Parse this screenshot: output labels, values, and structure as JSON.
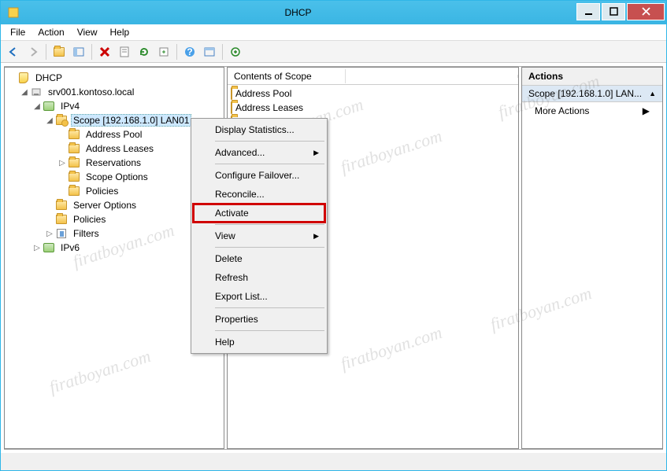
{
  "window": {
    "title": "DHCP"
  },
  "menubar": [
    "File",
    "Action",
    "View",
    "Help"
  ],
  "tree": {
    "root": "DHCP",
    "server": "srv001.kontoso.local",
    "ipv4": "IPv4",
    "ipv6": "IPv6",
    "scope": "Scope [192.168.1.0] LAN01",
    "addressPool": "Address Pool",
    "addressLeases": "Address Leases",
    "reservations": "Reservations",
    "scopeOptions": "Scope Options",
    "scopePolicies": "Policies",
    "serverOptions": "Server Options",
    "policies": "Policies",
    "filters": "Filters"
  },
  "mid": {
    "header": "Contents of Scope",
    "items": [
      "Address Pool",
      "Address Leases",
      "Reservations"
    ]
  },
  "actions": {
    "header": "Actions",
    "group": "Scope [192.168.1.0] LAN...",
    "more": "More Actions"
  },
  "context": {
    "displayStats": "Display Statistics...",
    "advanced": "Advanced...",
    "configureFailover": "Configure Failover...",
    "reconcile": "Reconcile...",
    "activate": "Activate",
    "view": "View",
    "delete": "Delete",
    "refresh": "Refresh",
    "exportList": "Export List...",
    "properties": "Properties",
    "help": "Help"
  },
  "watermark": "firatboyan.com"
}
